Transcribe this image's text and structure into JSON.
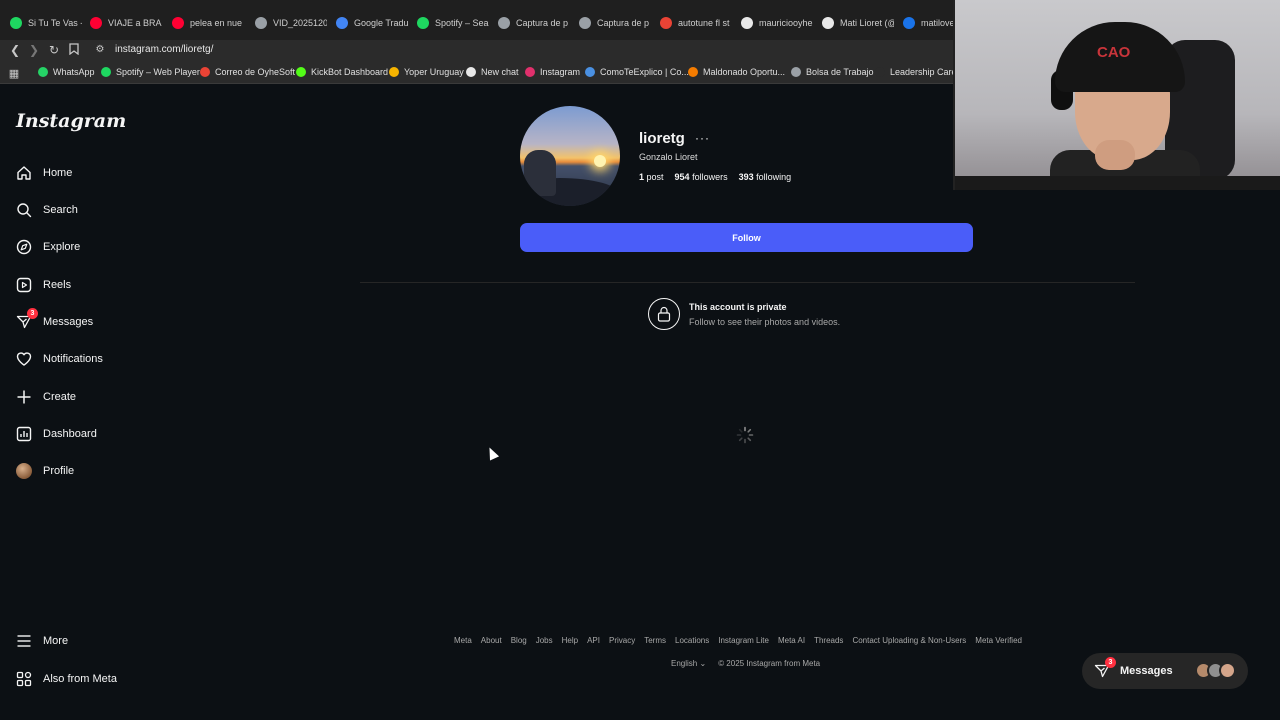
{
  "browser": {
    "tabs": [
      {
        "title": "Si Tu Te Vas -",
        "color": "#1ed760"
      },
      {
        "title": "VIAJE a BRAS",
        "color": "#ff0033"
      },
      {
        "title": "pelea en nue",
        "color": "#ff0033"
      },
      {
        "title": "VID_2025120",
        "color": "#9aa0a6"
      },
      {
        "title": "Google Tradu",
        "color": "#4285f4"
      },
      {
        "title": "Spotify – Sea",
        "color": "#1ed760"
      },
      {
        "title": "Captura de p",
        "color": "#9aa0a6"
      },
      {
        "title": "Captura de p",
        "color": "#9aa0a6"
      },
      {
        "title": "autotune fl st",
        "color": "#ea4335"
      },
      {
        "title": "mauriciooyhe",
        "color": "#e8e8e8"
      },
      {
        "title": "Mati Lioret (@",
        "color": "#e8e8e8"
      },
      {
        "title": "matilover",
        "color": "#1a73e8"
      }
    ],
    "url": "instagram.com/lioretg/",
    "bookmarks": [
      {
        "label": "WhatsApp",
        "color": "#25d366"
      },
      {
        "label": "Spotify – Web Player",
        "color": "#1ed760"
      },
      {
        "label": "Correo de OyheSoft",
        "color": "#ea4335"
      },
      {
        "label": "KickBot Dashboard",
        "color": "#53fc18"
      },
      {
        "label": "Yoper Uruguay",
        "color": "#f6b400"
      },
      {
        "label": "New chat",
        "color": "#e8e8e8"
      },
      {
        "label": "Instagram",
        "color": "#e1306c"
      },
      {
        "label": "ComoTeExplico | Co...",
        "color": "#4a90e2"
      },
      {
        "label": "Maldonado Oportu...",
        "color": "#f57c00"
      },
      {
        "label": "Bolsa de Trabajo",
        "color": "#9aa0a6"
      },
      {
        "label": "Leadership Career",
        "color": "#2b2b2b"
      }
    ]
  },
  "instagram": {
    "logo": "Instagram",
    "nav": [
      {
        "label": "Home",
        "icon": "home-icon"
      },
      {
        "label": "Search",
        "icon": "search-icon"
      },
      {
        "label": "Explore",
        "icon": "explore-icon"
      },
      {
        "label": "Reels",
        "icon": "reels-icon"
      },
      {
        "label": "Messages",
        "icon": "messages-icon",
        "badge": "3"
      },
      {
        "label": "Notifications",
        "icon": "heart-icon"
      },
      {
        "label": "Create",
        "icon": "plus-icon"
      },
      {
        "label": "Dashboard",
        "icon": "dashboard-icon"
      },
      {
        "label": "Profile",
        "icon": "avatar"
      }
    ],
    "nav_bottom": [
      {
        "label": "More",
        "icon": "menu-icon"
      },
      {
        "label": "Also from Meta",
        "icon": "meta-apps-icon"
      }
    ],
    "profile": {
      "username": "lioretg",
      "full_name": "Gonzalo Lioret",
      "posts_count": "1",
      "posts_label": "post",
      "followers_count": "954",
      "followers_label": "followers",
      "following_count": "393",
      "following_label": "following",
      "follow_button": "Follow",
      "private_title": "This account is private",
      "private_subtitle": "Follow to see their photos and videos."
    },
    "footer": {
      "links": [
        "Meta",
        "About",
        "Blog",
        "Jobs",
        "Help",
        "API",
        "Privacy",
        "Terms",
        "Locations",
        "Instagram Lite",
        "Meta AI",
        "Threads",
        "Contact Uploading & Non-Users",
        "Meta Verified"
      ],
      "language": "English",
      "copyright": "© 2025 Instagram from Meta"
    },
    "messages_pill": {
      "label": "Messages",
      "badge": "3"
    },
    "accent_color": "#4a5df9"
  },
  "webcam": {
    "cap_text": "CAO"
  }
}
